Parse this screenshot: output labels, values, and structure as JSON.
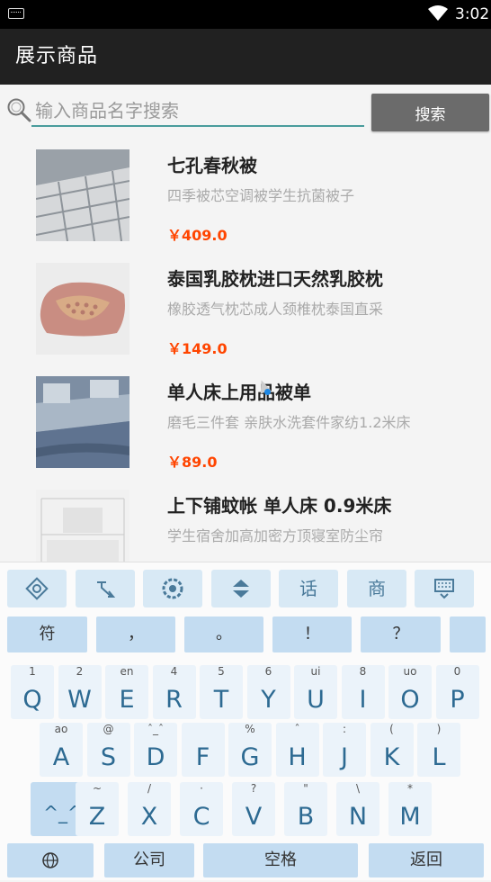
{
  "status_bar": {
    "time": "3:02",
    "keyboard_icon": "keyboard-icon",
    "wifi_icon": "wifi-icon"
  },
  "app_bar": {
    "title": "展示商品"
  },
  "search": {
    "placeholder": "输入商品名字搜索",
    "value": "",
    "button_label": "搜索",
    "icon": "search-icon"
  },
  "products": [
    {
      "name": "七孔春秋被",
      "desc": "四季被芯空调被学生抗菌被子",
      "price": "￥409.0"
    },
    {
      "name": "泰国乳胶枕进口天然乳胶枕",
      "desc": "橡胶透气枕芯成人颈椎枕泰国直采",
      "price": "￥149.0"
    },
    {
      "name": "单人床上用品被单",
      "desc": "磨毛三件套 亲肤水洗套件家纺1.2米床",
      "price": "￥89.0"
    },
    {
      "name": "上下铺蚊帐 单人床 0.9米床",
      "desc": "学生宿舍加高加密方顶寝室防尘帘",
      "price": ""
    }
  ],
  "keyboard": {
    "toolbar": [
      {
        "icon": "settings-icon",
        "label": ""
      },
      {
        "icon": "cursor-icon",
        "label": ""
      },
      {
        "icon": "gear-icon",
        "label": ""
      },
      {
        "icon": "expand-collapse-icon",
        "label": ""
      },
      {
        "icon": "",
        "label": "话"
      },
      {
        "icon": "",
        "label": "商"
      },
      {
        "icon": "hide-keyboard-icon",
        "label": ""
      }
    ],
    "symbols": [
      "符",
      "，",
      "。",
      "！",
      "？"
    ],
    "row1": [
      {
        "main": "Q",
        "sub": "1"
      },
      {
        "main": "W",
        "sub": "2"
      },
      {
        "main": "E",
        "sub": "en"
      },
      {
        "main": "R",
        "sub": "4"
      },
      {
        "main": "T",
        "sub": "5"
      },
      {
        "main": "Y",
        "sub": "6"
      },
      {
        "main": "U",
        "sub": "ui"
      },
      {
        "main": "I",
        "sub": "8"
      },
      {
        "main": "O",
        "sub": "uo"
      },
      {
        "main": "P",
        "sub": "0"
      }
    ],
    "row2": [
      {
        "main": "A",
        "sub": "ao"
      },
      {
        "main": "S",
        "sub": "@"
      },
      {
        "main": "D",
        "sub": "ˆ_ˆ"
      },
      {
        "main": "F",
        "sub": ""
      },
      {
        "main": "G",
        "sub": "%"
      },
      {
        "main": "H",
        "sub": "ˆ"
      },
      {
        "main": "J",
        "sub": ":"
      },
      {
        "main": "K",
        "sub": "("
      },
      {
        "main": "L",
        "sub": ")"
      }
    ],
    "row3": [
      {
        "main": "^_^",
        "sub": ""
      },
      {
        "main": "Z",
        "sub": "~"
      },
      {
        "main": "X",
        "sub": "/"
      },
      {
        "main": "C",
        "sub": "·"
      },
      {
        "main": "V",
        "sub": "?"
      },
      {
        "main": "B",
        "sub": "\""
      },
      {
        "main": "N",
        "sub": "\\"
      },
      {
        "main": "M",
        "sub": "*"
      }
    ],
    "bottom": {
      "globe_icon": "globe-icon",
      "left": "公司",
      "space": "空格",
      "return": "返回"
    }
  }
}
